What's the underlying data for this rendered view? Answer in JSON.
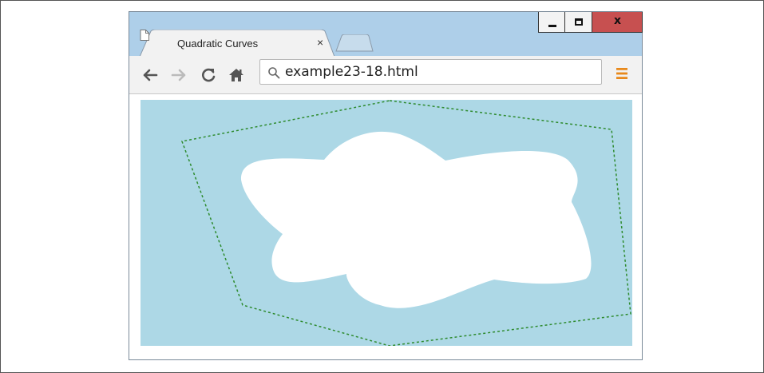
{
  "tab": {
    "title": "Quadratic Curves",
    "close_glyph": "×",
    "icon": "document-icon"
  },
  "window_controls": {
    "minimize_icon": "minimize-icon",
    "maximize_icon": "maximize-icon",
    "close_label": "x"
  },
  "toolbar": {
    "back_icon": "arrow-left-icon",
    "forward_icon": "arrow-right-icon",
    "reload_icon": "reload-icon",
    "home_icon": "home-icon",
    "menu_icon": "hamburger-menu-icon"
  },
  "omnibox": {
    "search_icon": "search-icon",
    "url": "example23-18.html"
  },
  "canvas": {
    "background_color": "#add8e6",
    "cloud_fill": "#ffffff",
    "dotted_outline_color": "#2e8b2e"
  },
  "colors": {
    "frame_background": "#aecfe9",
    "close_button": "#c75050",
    "menu_accent": "#e8891c"
  }
}
